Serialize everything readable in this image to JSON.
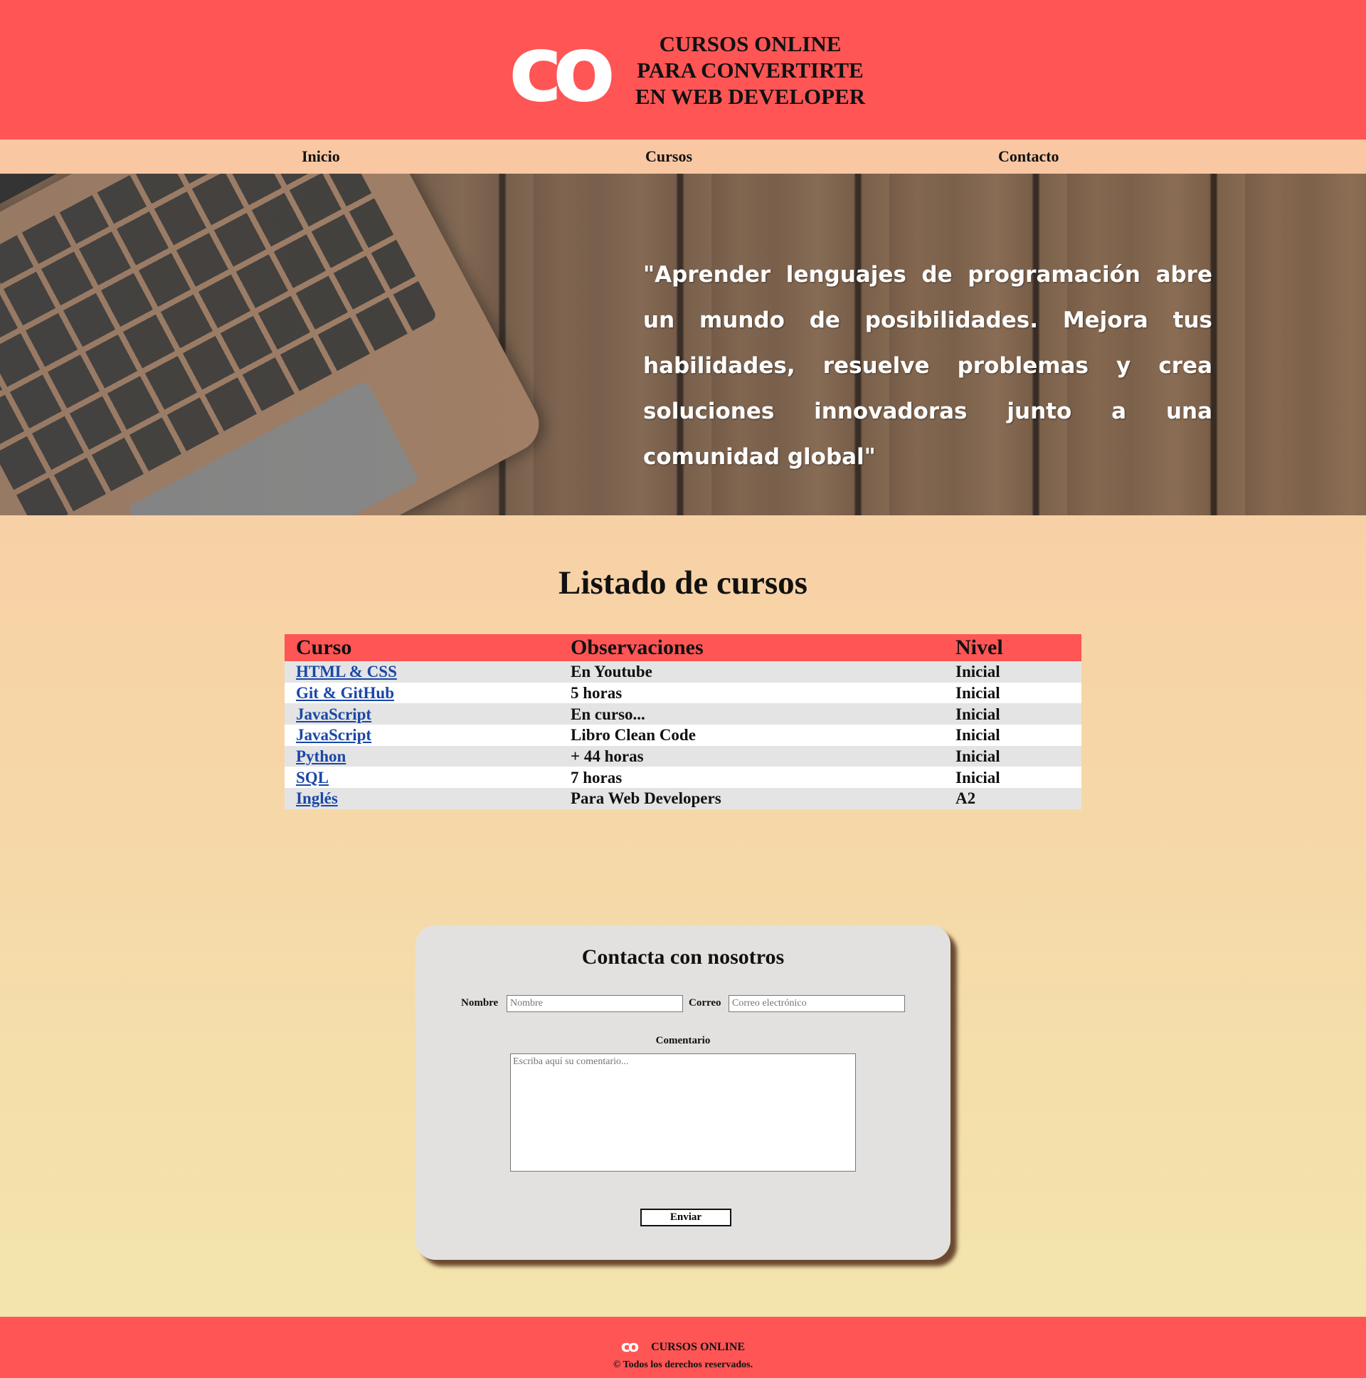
{
  "header": {
    "logo": "co",
    "title_lines": [
      "CURSOS ONLINE",
      "PARA CONVERTIRTE",
      "EN WEB DEVELOPER"
    ]
  },
  "nav": {
    "items": [
      {
        "label": "Inicio"
      },
      {
        "label": "Cursos"
      },
      {
        "label": "Contacto"
      }
    ]
  },
  "hero": {
    "quote": "\"Aprender lenguajes de programación abre un mundo de posibilidades. Mejora tus habilidades, resuelve problemas y crea soluciones innovadoras junto a una comunidad global\""
  },
  "courses": {
    "title": "Listado de cursos",
    "headers": [
      "Curso",
      "Observaciones",
      "Nivel"
    ],
    "rows": [
      {
        "course": "HTML & CSS",
        "notes": "En Youtube",
        "level": "Inicial"
      },
      {
        "course": "Git & GitHub",
        "notes": "5 horas",
        "level": "Inicial"
      },
      {
        "course": "JavaScript",
        "notes": "En curso...",
        "level": "Inicial"
      },
      {
        "course": "JavaScript",
        "notes": "Libro Clean Code",
        "level": "Inicial"
      },
      {
        "course": "Python",
        "notes": "+ 44 horas",
        "level": "Inicial"
      },
      {
        "course": "SQL",
        "notes": "7 horas",
        "level": "Inicial"
      },
      {
        "course": "Inglés",
        "notes": "Para Web Developers",
        "level": "A2"
      }
    ]
  },
  "contact": {
    "title": "Contacta con nosotros",
    "name_label": "Nombre",
    "name_placeholder": "Nombre",
    "email_label": "Correo",
    "email_placeholder": "Correo electrónico",
    "comment_label": "Comentario",
    "comment_placeholder": "Escriba aquí su comentario...",
    "submit_label": "Enviar"
  },
  "footer": {
    "logo": "co",
    "brand": "CURSOS ONLINE",
    "copyright": "© Todos los derechos reservados."
  },
  "colors": {
    "primary": "#ff5555",
    "nav_bg": "#f9c7a2",
    "link": "#1a47a8"
  }
}
